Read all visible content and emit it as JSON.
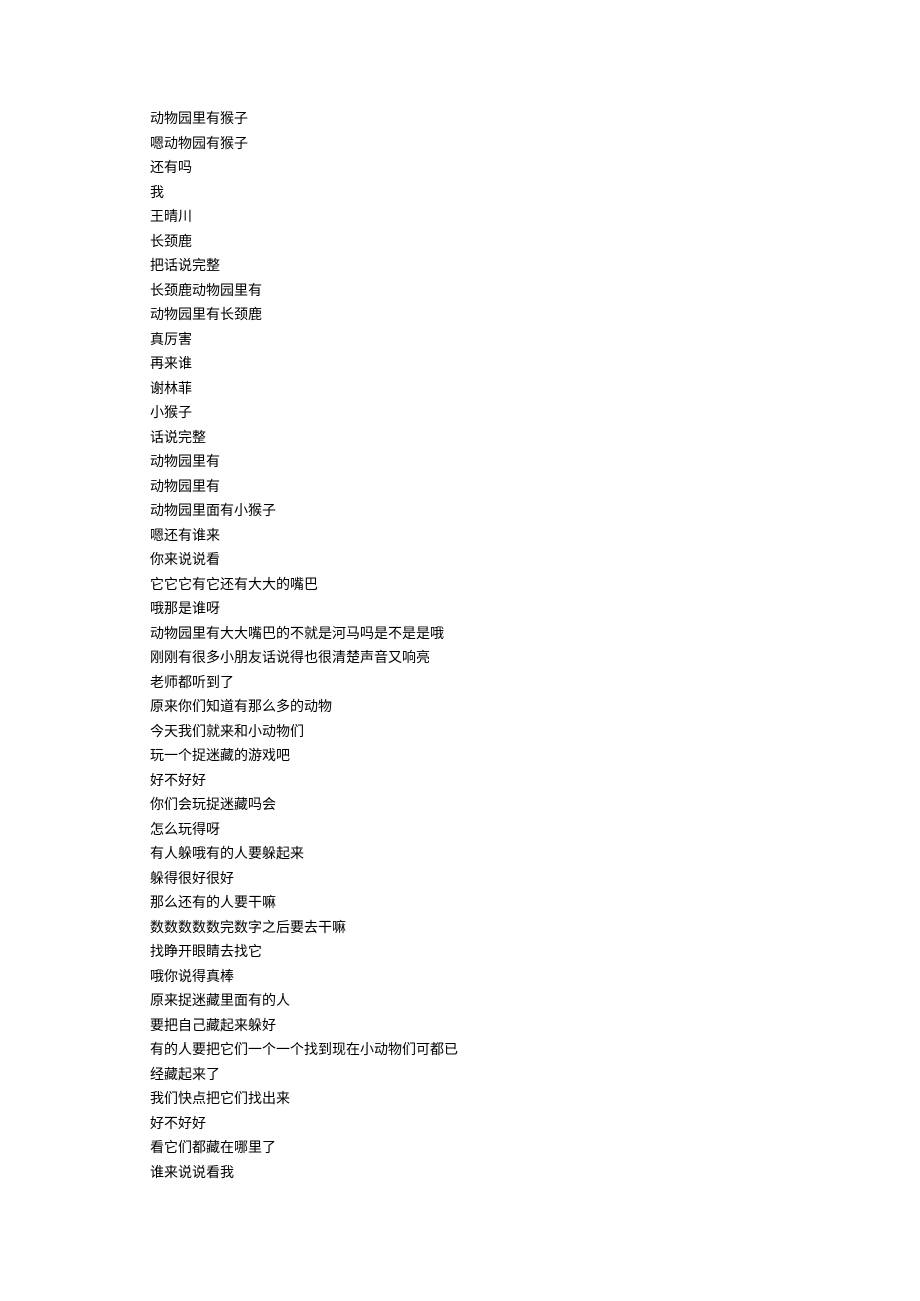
{
  "lines": [
    "动物园里有猴子",
    "嗯动物园有猴子",
    "还有吗",
    "我",
    "王晴川",
    "长颈鹿",
    "把话说完整",
    "长颈鹿动物园里有",
    "动物园里有长颈鹿",
    "真厉害",
    "再来谁",
    "谢林菲",
    "小猴子",
    "话说完整",
    "动物园里有",
    "动物园里有",
    "动物园里面有小猴子",
    "嗯还有谁来",
    "你来说说看",
    "它它它有它还有大大的嘴巴",
    "哦那是谁呀",
    "动物园里有大大嘴巴的不就是河马吗是不是是哦",
    "刚刚有很多小朋友话说得也很清楚声音又响亮",
    "老师都听到了",
    "原来你们知道有那么多的动物",
    "今天我们就来和小动物们",
    "玩一个捉迷藏的游戏吧",
    "好不好好",
    "你们会玩捉迷藏吗会",
    "怎么玩得呀",
    "有人躲哦有的人要躲起来",
    "躲得很好很好",
    "那么还有的人要干嘛",
    "数数数数数完数字之后要去干嘛",
    "找睁开眼睛去找它",
    "哦你说得真棒",
    "原来捉迷藏里面有的人",
    "要把自己藏起来躲好",
    "有的人要把它们一个一个找到现在小动物们可都已",
    "经藏起来了",
    "我们快点把它们找出来",
    "好不好好",
    "看它们都藏在哪里了",
    "谁来说说看我"
  ]
}
